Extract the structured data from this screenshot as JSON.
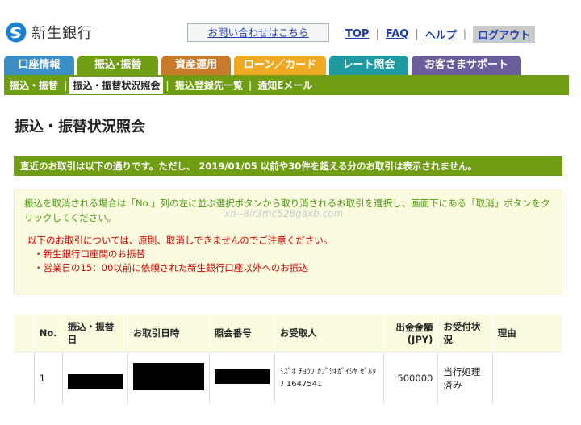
{
  "header": {
    "logo_text": "新生銀行",
    "contact_label": "お問い合わせはこちら",
    "links": [
      "TOP",
      "FAQ",
      "ヘルプ",
      "ログアウト"
    ]
  },
  "tabs": [
    {
      "label": "口座情報",
      "color": "#3a8ec4"
    },
    {
      "label": "振込･振替",
      "color": "#6f9d13"
    },
    {
      "label": "資産運用",
      "color": "#c77a2b"
    },
    {
      "label": "ローン／カード",
      "color": "#f0a922"
    },
    {
      "label": "レート照会",
      "color": "#1f9aa0"
    },
    {
      "label": "お客さまサポート",
      "color": "#6a5d9a"
    }
  ],
  "subnav": [
    "振込・振替",
    "振込・振替状況照会",
    "振込登録先一覧",
    "通知Eメール"
  ],
  "page_title": "振込・振替状況照会",
  "notice": "直近のお取引は以下の通りです。ただし、 2019/01/05 以前や30件を超える分のお取引は表示されません。",
  "info_text": "振込を取消される場合は「No.」列の左に並ぶ選択ボタンから取り消されるお取引を選択し、画面下にある「取消」ボタンをクリックしてください。",
  "watermark": "xn--8ir3mc528gaxb.com",
  "warning": {
    "head": "以下のお取引については、原則、取消しできませんのでご注意ください。",
    "items": [
      "新生銀行口座間のお振替",
      "営業日の15：00以前に依頼された新生銀行口座以外へのお振込"
    ]
  },
  "table": {
    "headers": [
      "No.",
      "振込・振替日",
      "お取引日時",
      "照会番号",
      "お受取人",
      "出金金額(JPY)",
      "お受付状況",
      "理由"
    ],
    "rows": [
      {
        "no": "1",
        "payee": "ﾐｽﾞﾎ ﾁﾖｳﾌ ｶﾌﾞｼｷｶﾞｲｼﾔ ｾﾞﾙﾀ ﾌ 1647541",
        "amount": "500000",
        "status": "当行処理済み",
        "reason": ""
      }
    ]
  },
  "colors": {
    "green": "#6f9d13",
    "link": "#1f3fa8",
    "warning": "#d40000",
    "info": "#4a9a10"
  }
}
